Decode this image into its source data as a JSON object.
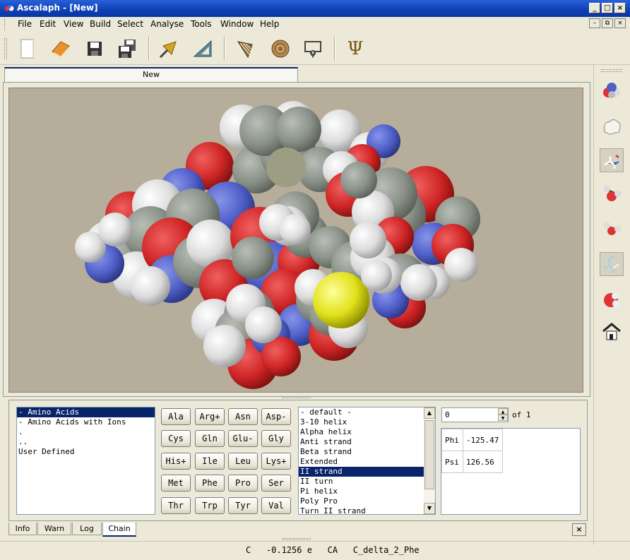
{
  "window": {
    "title": "Ascalaph - [New]",
    "controls": {
      "minimize": "_",
      "maximize": "□",
      "close": "×"
    }
  },
  "menubar": {
    "items": [
      "File",
      "Edit",
      "View",
      "Build",
      "Select",
      "Analyse",
      "Tools",
      "Window",
      "Help"
    ]
  },
  "toolbar": {
    "buttons": [
      "new-document-icon",
      "open-book-icon",
      "save-icon",
      "save-all-icon",
      "select-arrow-icon",
      "triangle-ruler-icon",
      "cone-shell-icon",
      "ammonite-icon",
      "contour-icon",
      "psi-icon"
    ],
    "psi_glyph": "Ψ"
  },
  "document_tab": {
    "label": "New"
  },
  "molecule": {
    "colors": {
      "carbon": "#8e948c",
      "hydrogen": "#e4e4e4",
      "oxygen": "#cf2525",
      "nitrogen": "#4f5fc8",
      "sulfur": "#e0e01a",
      "background": "#b6ad9b"
    }
  },
  "right_toolbar": {
    "buttons": [
      "spacefill-render-icon",
      "surface-outline-icon",
      "stick-render-icon",
      "ball-stick-icon",
      "ball-stick-small-icon",
      "wireframe-render-icon",
      "vdw-sphere-icon",
      "home-view-icon"
    ]
  },
  "chain_panel": {
    "library": [
      {
        "label": "- Amino Acids",
        "selected": true
      },
      {
        "label": "- Amino Acids with Ions",
        "selected": false
      },
      {
        "label": ".",
        "selected": false
      },
      {
        "label": "..",
        "selected": false
      },
      {
        "label": "User Defined",
        "selected": false
      }
    ],
    "residues": [
      [
        "Ala",
        "Arg+",
        "Asn",
        "Asp-"
      ],
      [
        "Cys",
        "Gln",
        "Glu-",
        "Gly"
      ],
      [
        "His+",
        "Ile",
        "Leu",
        "Lys+"
      ],
      [
        "Met",
        "Phe",
        "Pro",
        "Ser"
      ],
      [
        "Thr",
        "Trp",
        "Tyr",
        "Val"
      ]
    ],
    "conformations": [
      {
        "label": "- default -",
        "selected": false
      },
      {
        "label": "3-10 helix",
        "selected": false
      },
      {
        "label": "Alpha helix",
        "selected": false
      },
      {
        "label": "Anti strand",
        "selected": false
      },
      {
        "label": "Beta strand",
        "selected": false
      },
      {
        "label": "Extended",
        "selected": false
      },
      {
        "label": "II strand",
        "selected": true
      },
      {
        "label": "II turn",
        "selected": false
      },
      {
        "label": "Pi helix",
        "selected": false
      },
      {
        "label": "Poly Pro",
        "selected": false
      },
      {
        "label": "Turn II strand",
        "selected": false
      }
    ],
    "counter": {
      "value": "0",
      "of_label": "of 1"
    },
    "angles": [
      {
        "name": "Phi",
        "value": "-125.47"
      },
      {
        "name": "Psi",
        "value": "126.56"
      }
    ]
  },
  "bottom_tabs": [
    {
      "label": "Info",
      "active": false
    },
    {
      "label": "Warn",
      "active": false
    },
    {
      "label": "Log",
      "active": false
    },
    {
      "label": "Chain",
      "active": true
    }
  ],
  "close_panel_label": "×",
  "status": {
    "text": "C   -0.1256 e   CA   C_delta_2_Phe"
  }
}
